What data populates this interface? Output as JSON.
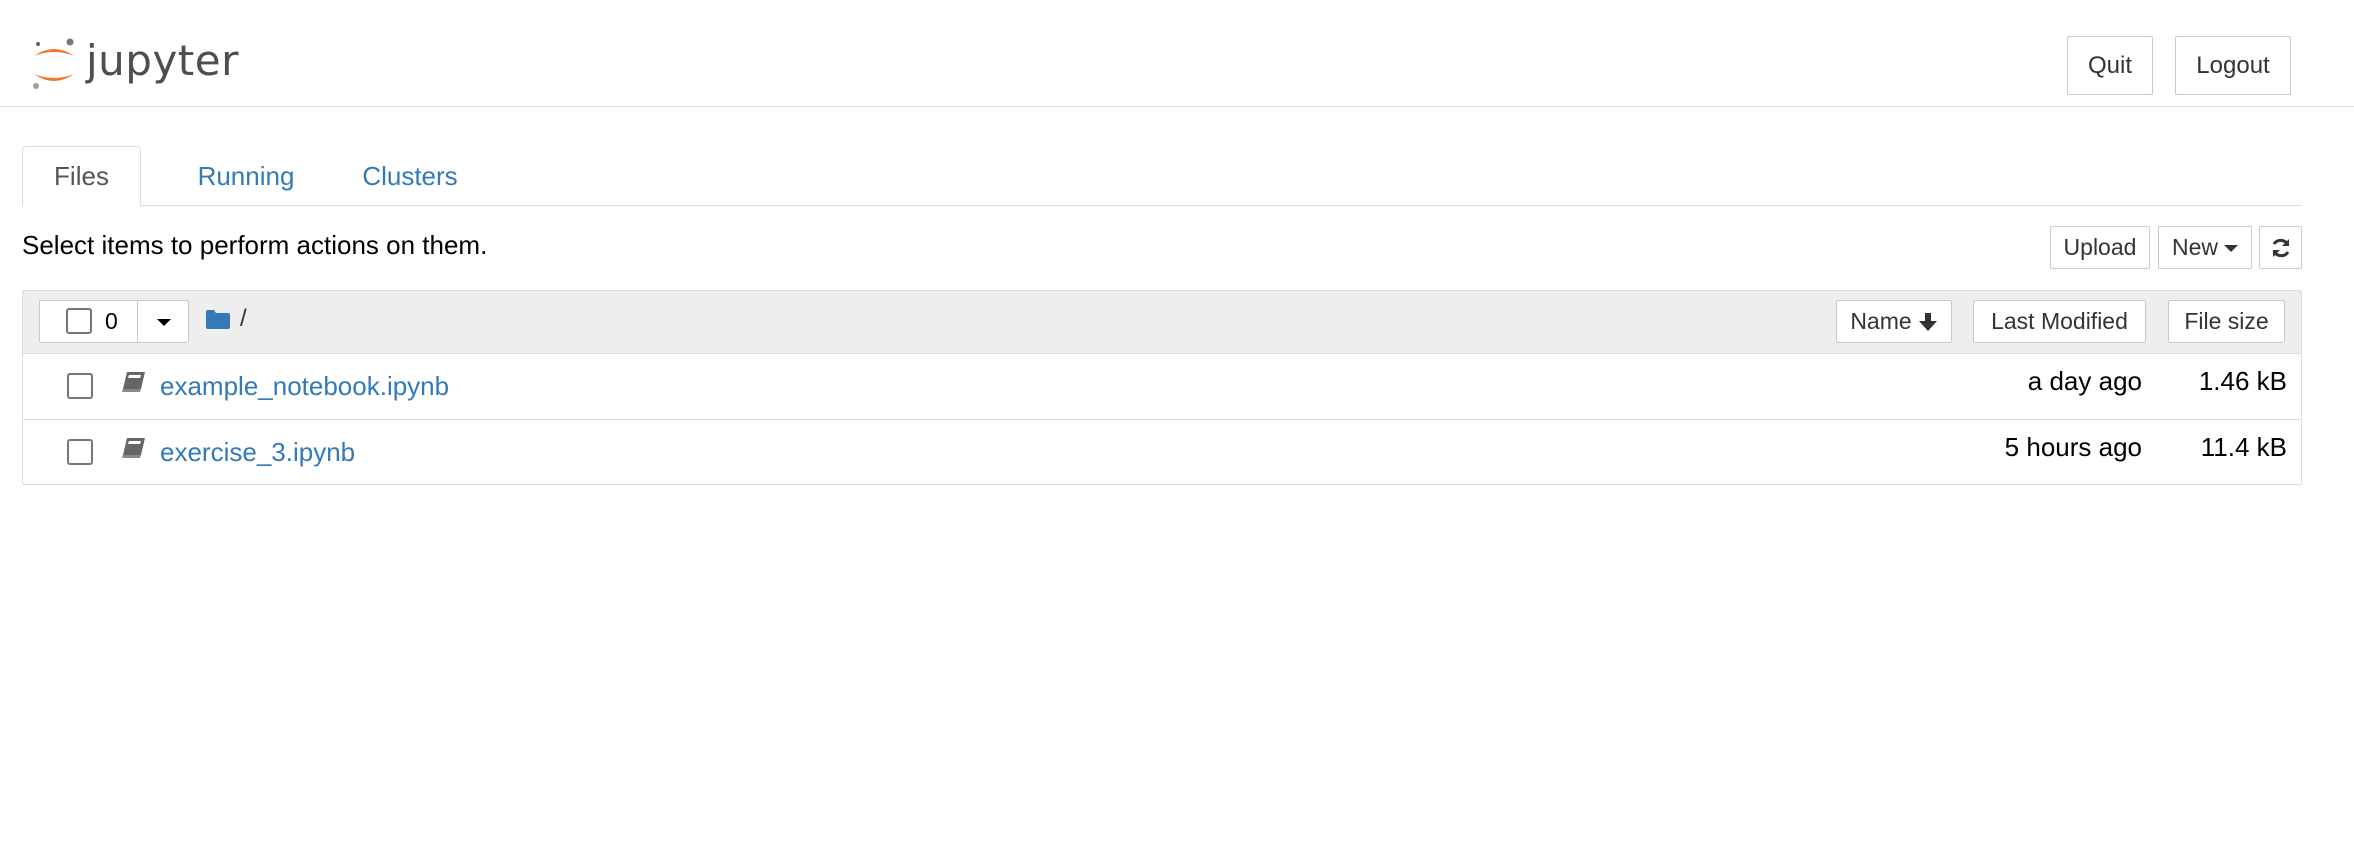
{
  "header": {
    "logo_text": "jupyter",
    "quit_label": "Quit",
    "logout_label": "Logout"
  },
  "tabs": [
    {
      "label": "Files",
      "active": true
    },
    {
      "label": "Running",
      "active": false
    },
    {
      "label": "Clusters",
      "active": false
    }
  ],
  "toolbar": {
    "notice": "Select items to perform actions on them.",
    "upload_label": "Upload",
    "new_label": "New",
    "refresh_icon": "refresh-icon"
  },
  "list": {
    "selected_count": "0",
    "path": "/",
    "columns": {
      "name": "Name",
      "last_modified": "Last Modified",
      "file_size": "File size"
    },
    "files": [
      {
        "name": "example_notebook.ipynb",
        "modified": "a day ago",
        "size": "1.46 kB",
        "icon": "notebook-icon"
      },
      {
        "name": "exercise_3.ipynb",
        "modified": "5 hours ago",
        "size": "11.4 kB",
        "icon": "notebook-icon"
      }
    ]
  },
  "colors": {
    "link": "#337ab7",
    "logo_orange": "#f37726",
    "header_bg": "#eeeeee"
  }
}
